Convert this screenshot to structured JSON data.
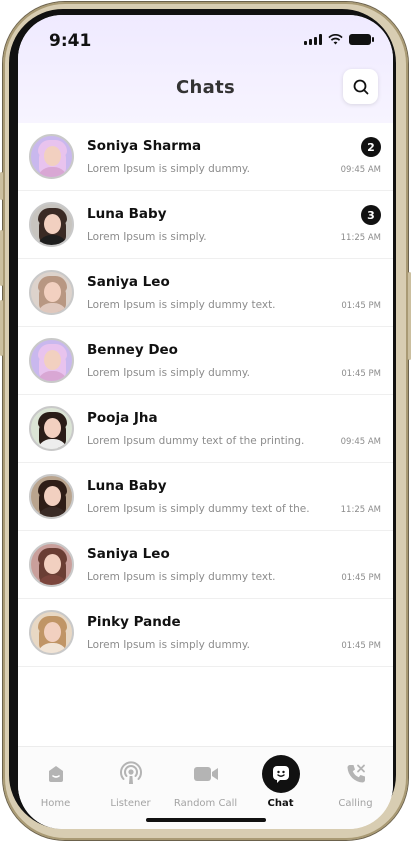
{
  "status_bar": {
    "time": "9:41"
  },
  "header": {
    "title": "Chats"
  },
  "chats": [
    {
      "name": "Soniya Sharma",
      "message": "Lorem Ipsum is simply dummy.",
      "time": "09:45 AM",
      "unread": "2",
      "avatar_bg": "#c9b8ee",
      "hair": "#e8c3ee",
      "top": "#d9a7d4"
    },
    {
      "name": "Luna Baby",
      "message": "Lorem Ipsum is simply.",
      "time": "11:25 AM",
      "unread": "3",
      "avatar_bg": "#c7c4bf",
      "hair": "#3a2a24",
      "top": "#1e1e1e"
    },
    {
      "name": "Saniya Leo",
      "message": "Lorem Ipsum is simply dummy text.",
      "time": "01:45 PM",
      "unread": "",
      "avatar_bg": "#ddd3cc",
      "hair": "#b89782",
      "top": "#e0c8bd"
    },
    {
      "name": "Benney Deo",
      "message": "Lorem Ipsum is simply dummy.",
      "time": "01:45 PM",
      "unread": "",
      "avatar_bg": "#c9b8ee",
      "hair": "#e8c3ee",
      "top": "#d9a7d4"
    },
    {
      "name": "Pooja Jha",
      "message": "Lorem Ipsum dummy text of the printing.",
      "time": "09:45 AM",
      "unread": "",
      "avatar_bg": "#dbe4d5",
      "hair": "#2a1d18",
      "top": "#ededed"
    },
    {
      "name": "Luna Baby",
      "message": "Lorem Ipsum is simply dummy text of the.",
      "time": "11:25 AM",
      "unread": "",
      "avatar_bg": "#b9a48e",
      "hair": "#2f1e17",
      "top": "#3a2b26"
    },
    {
      "name": "Saniya Leo",
      "message": "Lorem Ipsum is simply dummy text.",
      "time": "01:45 PM",
      "unread": "",
      "avatar_bg": "#c99f9b",
      "hair": "#6a3e34",
      "top": "#7b453c"
    },
    {
      "name": "Pinky Pande",
      "message": "Lorem Ipsum is simply dummy.",
      "time": "01:45 PM",
      "unread": "",
      "avatar_bg": "#e8d8c4",
      "hair": "#c09566",
      "top": "#f1e4d6"
    }
  ],
  "nav": [
    {
      "label": "Home",
      "icon": "home-icon"
    },
    {
      "label": "Listener",
      "icon": "podcast-icon"
    },
    {
      "label": "Random Call",
      "icon": "video-icon"
    },
    {
      "label": "Chat",
      "icon": "chat-smile-icon",
      "active": true
    },
    {
      "label": "Calling",
      "icon": "phone-icon"
    }
  ],
  "colors": {
    "accent": "#111111",
    "header_bg": "#efeaff",
    "muted": "#a3a3a3"
  }
}
